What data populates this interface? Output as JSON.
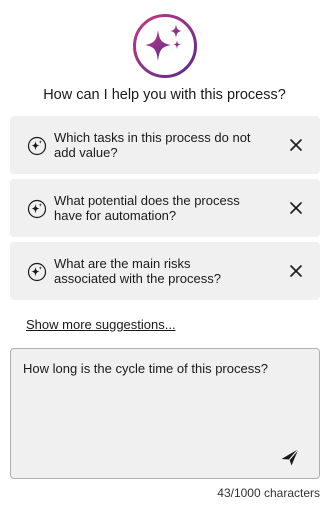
{
  "logo": {
    "icon": "sparkles-icon",
    "gradient_from": "#c02a7f",
    "gradient_to": "#5b2d8e"
  },
  "heading": "How can I help you with this process?",
  "suggestions": [
    {
      "line1": "Which tasks in this process do not",
      "line2": "add value?",
      "icon": "sparkle-icon",
      "dismiss_icon": "close-icon"
    },
    {
      "line1": "What potential does the process",
      "line2": "have for automation?",
      "icon": "sparkle-icon",
      "dismiss_icon": "close-icon"
    },
    {
      "line1": "What are the main risks",
      "line2": "associated with the process?",
      "icon": "sparkle-icon",
      "dismiss_icon": "close-icon"
    }
  ],
  "show_more_label": "Show more suggestions...",
  "input": {
    "value": "How long is the cycle time of this process?",
    "placeholder": ""
  },
  "send_icon": "send-icon",
  "counter": "43/1000 characters"
}
